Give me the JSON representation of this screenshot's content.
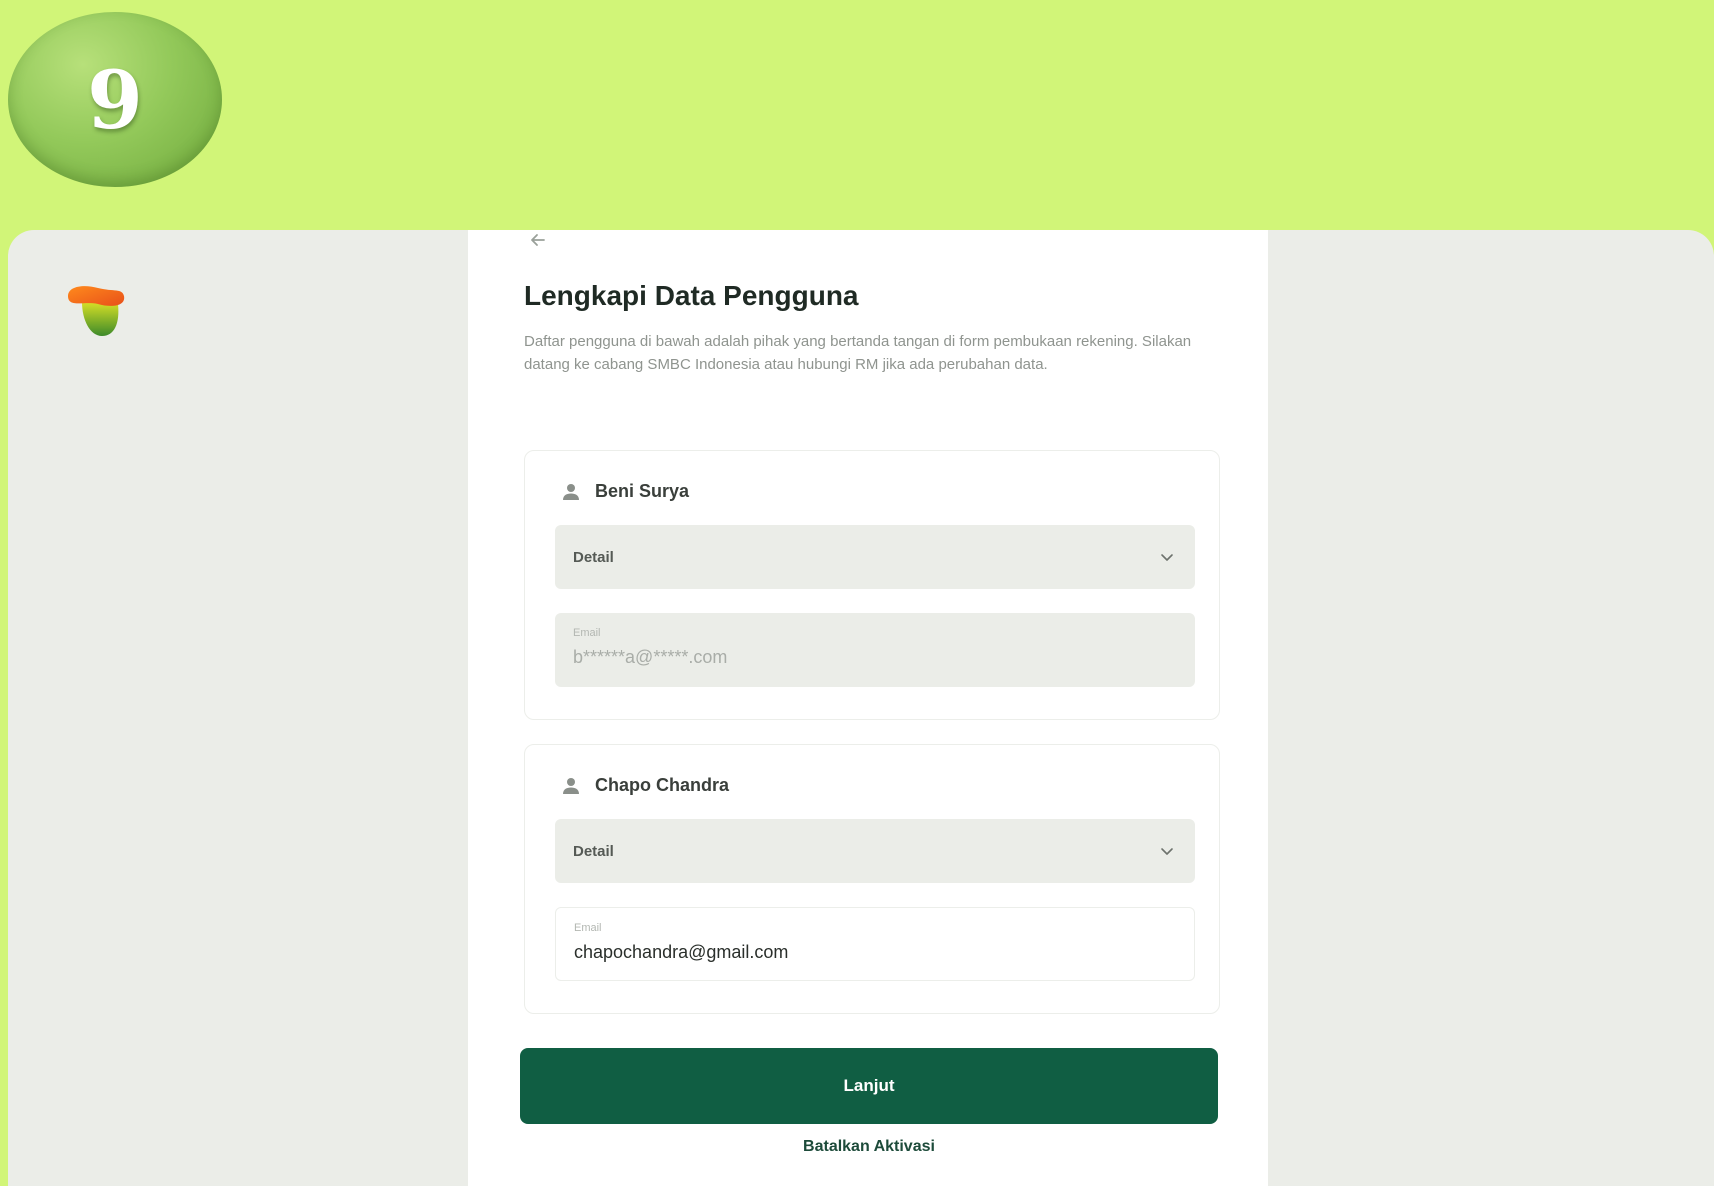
{
  "step": {
    "number": "9"
  },
  "page": {
    "title": "Lengkapi Data Pengguna",
    "description": "Daftar pengguna di bawah adalah pihak yang bertanda tangan di form pembukaan rekening. Silakan datang ke cabang SMBC Indonesia atau hubungi RM jika ada perubahan data."
  },
  "users": [
    {
      "name": "Beni Surya",
      "dropdown_label": "Detail",
      "email_label": "Email",
      "email_value": "b******a@*****.com"
    },
    {
      "name": "Chapo Chandra",
      "dropdown_label": "Detail",
      "email_label": "Email",
      "email_value": "chapochandra@gmail.com"
    }
  ],
  "actions": {
    "primary_label": "Lanjut",
    "cancel_label": "Batalkan Aktivasi"
  },
  "icons": {
    "back": "arrow-left-icon",
    "user": "person-icon",
    "dropdown": "chevron-down-icon"
  },
  "colors": {
    "background": "#d1f578",
    "primary_button": "#105e43",
    "screen_bg": "#ebede8"
  }
}
